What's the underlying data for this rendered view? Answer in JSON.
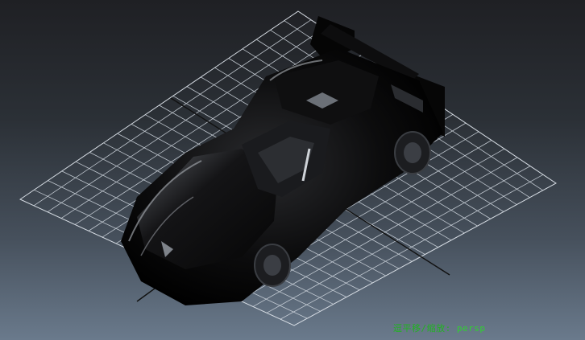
{
  "viewport": {
    "hud_label": "逗平移/缩放:",
    "camera_name": "persp"
  },
  "colors": {
    "grid_line": "#d7dde4",
    "axis_line": "#111111",
    "hud_text": "#2fd12f",
    "car_body": "#0b0b0c",
    "car_highlight": "#9a9ea4"
  },
  "icons": {
    "car_model": "sports-car-model"
  }
}
